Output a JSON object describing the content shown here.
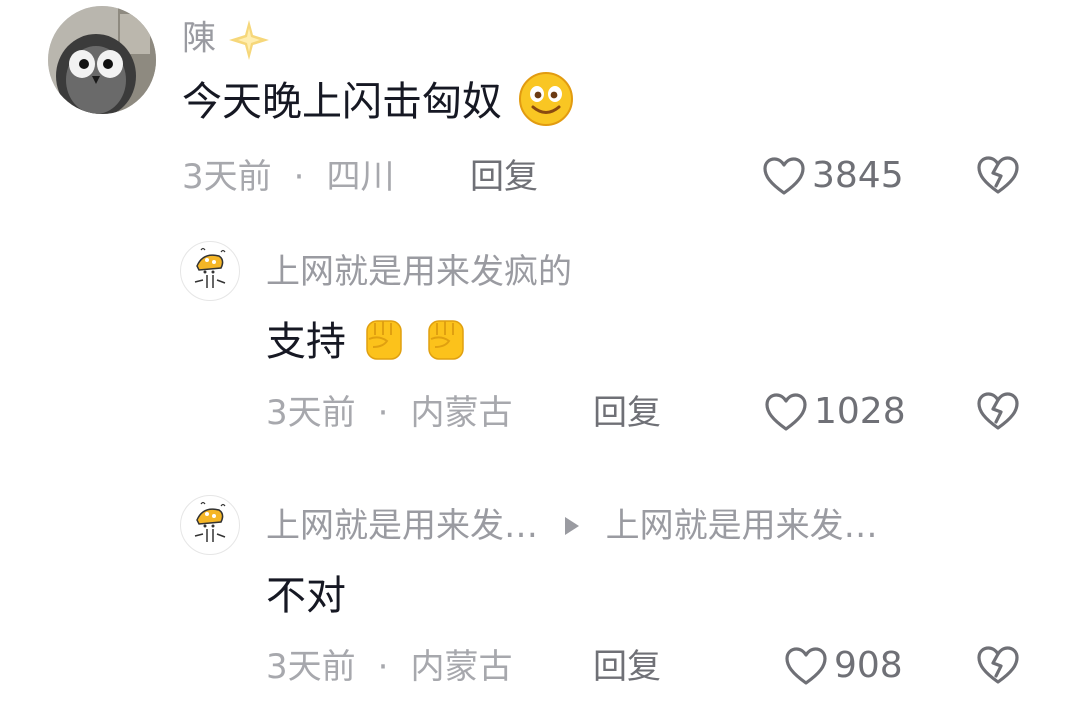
{
  "comments": [
    {
      "user": "陳",
      "user_badge_icon": "sparkle-star-icon",
      "text": "今天晚上闪击匈奴",
      "text_emoji_icon": "smiley-face-icon",
      "time": "3天前",
      "location": "四川",
      "reply_label": "回复",
      "likes": "3845"
    }
  ],
  "replies": [
    {
      "user": "上网就是用来发疯的",
      "text": "支持",
      "text_emoji_icons": [
        "raised-fist-icon",
        "raised-fist-icon"
      ],
      "time": "3天前",
      "location": "内蒙古",
      "reply_label": "回复",
      "likes": "1028"
    },
    {
      "user": "上网就是用来发…",
      "reply_to_icon": "play-arrow-icon",
      "reply_to": "上网就是用来发…",
      "text": "不对",
      "time": "3天前",
      "location": "内蒙古",
      "reply_label": "回复",
      "likes": "908"
    }
  ],
  "separator": "·",
  "colors": {
    "primary_text": "#161823",
    "secondary_text": "#a7a8ad",
    "action_text": "#6f7076"
  }
}
